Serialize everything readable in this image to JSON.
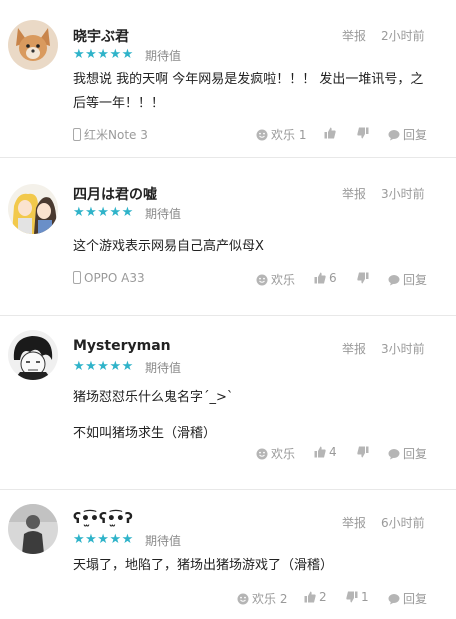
{
  "comments": [
    {
      "username": "晓宇ぶ君",
      "stars": "★★★★★",
      "rating_label": "期待值",
      "report": "举报",
      "time": "2小时前",
      "text_lines": [
        "我想说 我的天啊 今年网易是发疯啦！！！ 发出一堆讯号，之后等一年！！！"
      ],
      "device": "红米Note 3",
      "joy": "欢乐 1",
      "likes": "",
      "dislikes": "",
      "reply": "回复"
    },
    {
      "username": "四月は君の嘘",
      "stars": "★★★★★",
      "rating_label": "期待值",
      "report": "举报",
      "time": "3小时前",
      "text_lines": [
        "这个游戏表示网易自己高产似母X"
      ],
      "device": "OPPO A33",
      "joy": "欢乐",
      "likes": "6",
      "dislikes": "",
      "reply": "回复"
    },
    {
      "username": "Mysteryman",
      "stars": "★★★★★",
      "rating_label": "期待值",
      "report": "举报",
      "time": "3小时前",
      "text_lines": [
        "猪场怼怼乐什么鬼名字´_>`",
        "不如叫猪场求生（滑稽）"
      ],
      "device": "",
      "joy": "欢乐",
      "likes": "4",
      "dislikes": "",
      "reply": "回复"
    },
    {
      "username": "ʕ•̫͡•ʕ•̫͡•ʔ",
      "stars": "★★★★★",
      "rating_label": "期待值",
      "report": "举报",
      "time": "6小时前",
      "text_lines": [
        "天塌了，地陷了，猪场出猪场游戏了（滑稽）"
      ],
      "device": "",
      "joy": "欢乐 2",
      "likes": "2",
      "dislikes": "1",
      "reply": "回复"
    }
  ],
  "colors": {
    "star": "#2fb3c9",
    "meta": "#9a9a9a",
    "divider": "#e8e8e8"
  }
}
